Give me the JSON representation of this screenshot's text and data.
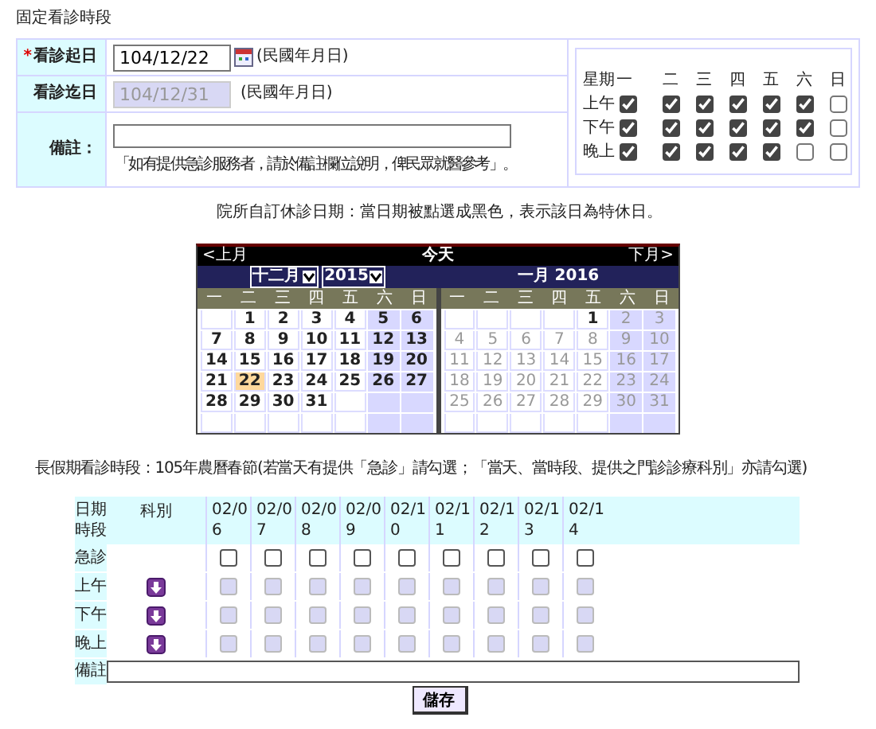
{
  "section_title": "固定看診時段",
  "fixed_form": {
    "start": {
      "required_mark": "*",
      "label": "看診起日",
      "value": "104/12/22",
      "hint": "(民國年月日)"
    },
    "end": {
      "label": "看診迄日",
      "value": "104/12/31",
      "disabled": true,
      "hint": "(民國年月日)"
    },
    "remark": {
      "label": "備註：",
      "note": "「如有提供急診服務者，請於備註欄位說明，俾民眾就醫參考」。"
    }
  },
  "weekly": {
    "corner": "星期",
    "days": [
      "一",
      "二",
      "三",
      "四",
      "五",
      "六",
      "日"
    ],
    "rows": [
      {
        "label": "上午",
        "checked": [
          true,
          true,
          true,
          true,
          true,
          true,
          false
        ]
      },
      {
        "label": "下午",
        "checked": [
          true,
          true,
          true,
          true,
          true,
          true,
          false
        ]
      },
      {
        "label": "晚上",
        "checked": [
          true,
          true,
          true,
          true,
          true,
          false,
          false
        ]
      }
    ]
  },
  "closure_note": "院所自訂休診日期：當日期被點選成黑色，表示該日為特休日。",
  "calendar": {
    "prev": "<上月",
    "today": "今天",
    "next": "下月>",
    "month_select": "十二月",
    "year_select": "2015",
    "second_title": "一月 2016",
    "months": [
      {
        "weekdays": [
          "一",
          "二",
          "三",
          "四",
          "五",
          "六",
          "日"
        ],
        "weeks": [
          [
            {
              "kind": "blank"
            },
            {
              "kind": "day",
              "day": "1",
              "disabled": false,
              "selected": false
            },
            {
              "kind": "day",
              "day": "2",
              "disabled": false,
              "selected": false
            },
            {
              "kind": "day",
              "day": "3",
              "disabled": false,
              "selected": false
            },
            {
              "kind": "day",
              "day": "4",
              "disabled": false,
              "selected": false
            },
            {
              "kind": "day",
              "day": "5",
              "disabled": false,
              "selected": false
            },
            {
              "kind": "day",
              "day": "6",
              "disabled": false,
              "selected": false
            }
          ],
          [
            {
              "kind": "day",
              "day": "7",
              "disabled": false,
              "selected": false
            },
            {
              "kind": "day",
              "day": "8",
              "disabled": false,
              "selected": false
            },
            {
              "kind": "day",
              "day": "9",
              "disabled": false,
              "selected": false
            },
            {
              "kind": "day",
              "day": "10",
              "disabled": false,
              "selected": false
            },
            {
              "kind": "day",
              "day": "11",
              "disabled": false,
              "selected": false
            },
            {
              "kind": "day",
              "day": "12",
              "disabled": false,
              "selected": false
            },
            {
              "kind": "day",
              "day": "13",
              "disabled": false,
              "selected": false
            }
          ],
          [
            {
              "kind": "day",
              "day": "14",
              "disabled": false,
              "selected": false
            },
            {
              "kind": "day",
              "day": "15",
              "disabled": false,
              "selected": false
            },
            {
              "kind": "day",
              "day": "16",
              "disabled": false,
              "selected": false
            },
            {
              "kind": "day",
              "day": "17",
              "disabled": false,
              "selected": false
            },
            {
              "kind": "day",
              "day": "18",
              "disabled": false,
              "selected": false
            },
            {
              "kind": "day",
              "day": "19",
              "disabled": false,
              "selected": false
            },
            {
              "kind": "day",
              "day": "20",
              "disabled": false,
              "selected": false
            }
          ],
          [
            {
              "kind": "day",
              "day": "21",
              "disabled": false,
              "selected": false
            },
            {
              "kind": "day",
              "day": "22",
              "disabled": false,
              "selected": true
            },
            {
              "kind": "day",
              "day": "23",
              "disabled": false,
              "selected": false
            },
            {
              "kind": "day",
              "day": "24",
              "disabled": false,
              "selected": false
            },
            {
              "kind": "day",
              "day": "25",
              "disabled": false,
              "selected": false
            },
            {
              "kind": "day",
              "day": "26",
              "disabled": false,
              "selected": false
            },
            {
              "kind": "day",
              "day": "27",
              "disabled": false,
              "selected": false
            }
          ],
          [
            {
              "kind": "day",
              "day": "28",
              "disabled": false,
              "selected": false
            },
            {
              "kind": "day",
              "day": "29",
              "disabled": false,
              "selected": false
            },
            {
              "kind": "day",
              "day": "30",
              "disabled": false,
              "selected": false
            },
            {
              "kind": "day",
              "day": "31",
              "disabled": false,
              "selected": false
            },
            {
              "kind": "blank"
            },
            {
              "kind": "blank"
            },
            {
              "kind": "blank"
            }
          ],
          [
            {
              "kind": "blank"
            },
            {
              "kind": "blank"
            },
            {
              "kind": "blank"
            },
            {
              "kind": "blank"
            },
            {
              "kind": "blank"
            },
            {
              "kind": "blank"
            },
            {
              "kind": "blank"
            }
          ]
        ]
      },
      {
        "weekdays": [
          "一",
          "二",
          "三",
          "四",
          "五",
          "六",
          "日"
        ],
        "weeks": [
          [
            {
              "kind": "blank"
            },
            {
              "kind": "blank"
            },
            {
              "kind": "blank"
            },
            {
              "kind": "blank"
            },
            {
              "kind": "day",
              "day": "1",
              "disabled": false,
              "selected": false
            },
            {
              "kind": "day",
              "day": "2",
              "disabled": true,
              "selected": false
            },
            {
              "kind": "day",
              "day": "3",
              "disabled": true,
              "selected": false
            }
          ],
          [
            {
              "kind": "day",
              "day": "4",
              "disabled": true,
              "selected": false
            },
            {
              "kind": "day",
              "day": "5",
              "disabled": true,
              "selected": false
            },
            {
              "kind": "day",
              "day": "6",
              "disabled": true,
              "selected": false
            },
            {
              "kind": "day",
              "day": "7",
              "disabled": true,
              "selected": false
            },
            {
              "kind": "day",
              "day": "8",
              "disabled": true,
              "selected": false
            },
            {
              "kind": "day",
              "day": "9",
              "disabled": true,
              "selected": false
            },
            {
              "kind": "day",
              "day": "10",
              "disabled": true,
              "selected": false
            }
          ],
          [
            {
              "kind": "day",
              "day": "11",
              "disabled": true,
              "selected": false
            },
            {
              "kind": "day",
              "day": "12",
              "disabled": true,
              "selected": false
            },
            {
              "kind": "day",
              "day": "13",
              "disabled": true,
              "selected": false
            },
            {
              "kind": "day",
              "day": "14",
              "disabled": true,
              "selected": false
            },
            {
              "kind": "day",
              "day": "15",
              "disabled": true,
              "selected": false
            },
            {
              "kind": "day",
              "day": "16",
              "disabled": true,
              "selected": false
            },
            {
              "kind": "day",
              "day": "17",
              "disabled": true,
              "selected": false
            }
          ],
          [
            {
              "kind": "day",
              "day": "18",
              "disabled": true,
              "selected": false
            },
            {
              "kind": "day",
              "day": "19",
              "disabled": true,
              "selected": false
            },
            {
              "kind": "day",
              "day": "20",
              "disabled": true,
              "selected": false
            },
            {
              "kind": "day",
              "day": "21",
              "disabled": true,
              "selected": false
            },
            {
              "kind": "day",
              "day": "22",
              "disabled": true,
              "selected": false
            },
            {
              "kind": "day",
              "day": "23",
              "disabled": true,
              "selected": false
            },
            {
              "kind": "day",
              "day": "24",
              "disabled": true,
              "selected": false
            }
          ],
          [
            {
              "kind": "day",
              "day": "25",
              "disabled": true,
              "selected": false
            },
            {
              "kind": "day",
              "day": "26",
              "disabled": true,
              "selected": false
            },
            {
              "kind": "day",
              "day": "27",
              "disabled": true,
              "selected": false
            },
            {
              "kind": "day",
              "day": "28",
              "disabled": true,
              "selected": false
            },
            {
              "kind": "day",
              "day": "29",
              "disabled": true,
              "selected": false
            },
            {
              "kind": "day",
              "day": "30",
              "disabled": true,
              "selected": false
            },
            {
              "kind": "day",
              "day": "31",
              "disabled": true,
              "selected": false
            }
          ],
          [
            {
              "kind": "blank"
            },
            {
              "kind": "blank"
            },
            {
              "kind": "blank"
            },
            {
              "kind": "blank"
            },
            {
              "kind": "blank"
            },
            {
              "kind": "blank"
            },
            {
              "kind": "blank"
            }
          ]
        ]
      }
    ]
  },
  "holiday": {
    "title": "長假期看診時段：105年農曆春節(若當天有提供「急診」請勾選；「當天、當時段、提供之門診診療科別」亦請勾選)",
    "corner": [
      "日期",
      "時段"
    ],
    "dept_header": "科別",
    "dates": [
      "02/06",
      "02/07",
      "02/08",
      "02/09",
      "02/10",
      "02/11",
      "02/12",
      "02/13",
      "02/14"
    ],
    "rows": [
      {
        "label": "急診",
        "kind": "emergency",
        "disabled": false,
        "checked": [
          false,
          false,
          false,
          false,
          false,
          false,
          false,
          false,
          false
        ]
      },
      {
        "label": "上午",
        "kind": "slot",
        "disabled": true,
        "checked": [
          false,
          false,
          false,
          false,
          false,
          false,
          false,
          false,
          false
        ]
      },
      {
        "label": "下午",
        "kind": "slot",
        "disabled": true,
        "checked": [
          false,
          false,
          false,
          false,
          false,
          false,
          false,
          false,
          false
        ]
      },
      {
        "label": "晚上",
        "kind": "slot",
        "disabled": true,
        "checked": [
          false,
          false,
          false,
          false,
          false,
          false,
          false,
          false,
          false
        ]
      }
    ],
    "remark_label": "備註",
    "save": "儲存"
  }
}
